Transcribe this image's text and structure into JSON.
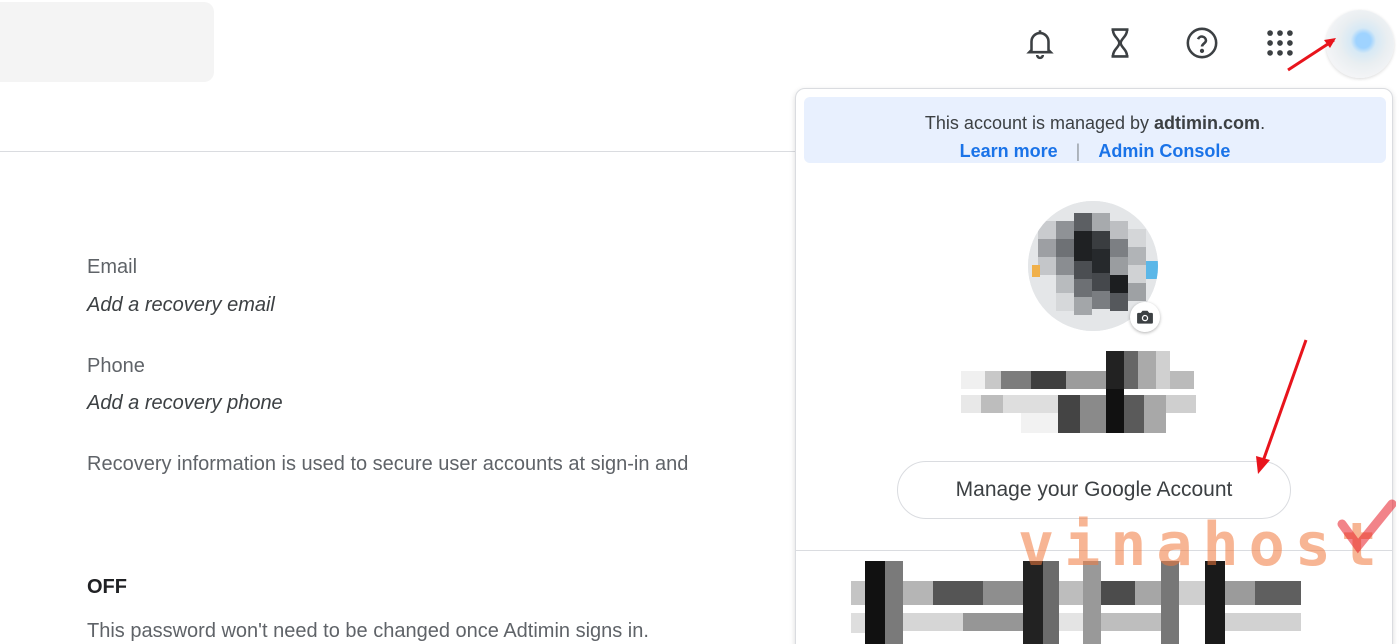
{
  "header": {
    "icons": [
      "bell-icon",
      "hourglass-icon",
      "help-icon",
      "apps-grid-icon",
      "avatar"
    ]
  },
  "recovery": {
    "email_label": "Email",
    "email_value": "Add a recovery email",
    "phone_label": "Phone",
    "phone_value": "Add a recovery phone",
    "info_text": "Recovery information is used to secure user accounts at sign-in and"
  },
  "password": {
    "status": "OFF",
    "note": "This password won't need to be changed once Adtimin signs in."
  },
  "account_popup": {
    "managed_prefix": "This account is managed by ",
    "managed_domain": "adtimin.com",
    "managed_suffix": ".",
    "learn_more": "Learn more",
    "admin_console": "Admin Console",
    "manage_button": "Manage your Google Account"
  },
  "watermark": {
    "text": "vinahost."
  },
  "colors": {
    "link_blue": "#1a73e8",
    "banner_bg": "#e8f0fe",
    "arrow_red": "#e8141c",
    "watermark_orange": "#f0783c"
  }
}
